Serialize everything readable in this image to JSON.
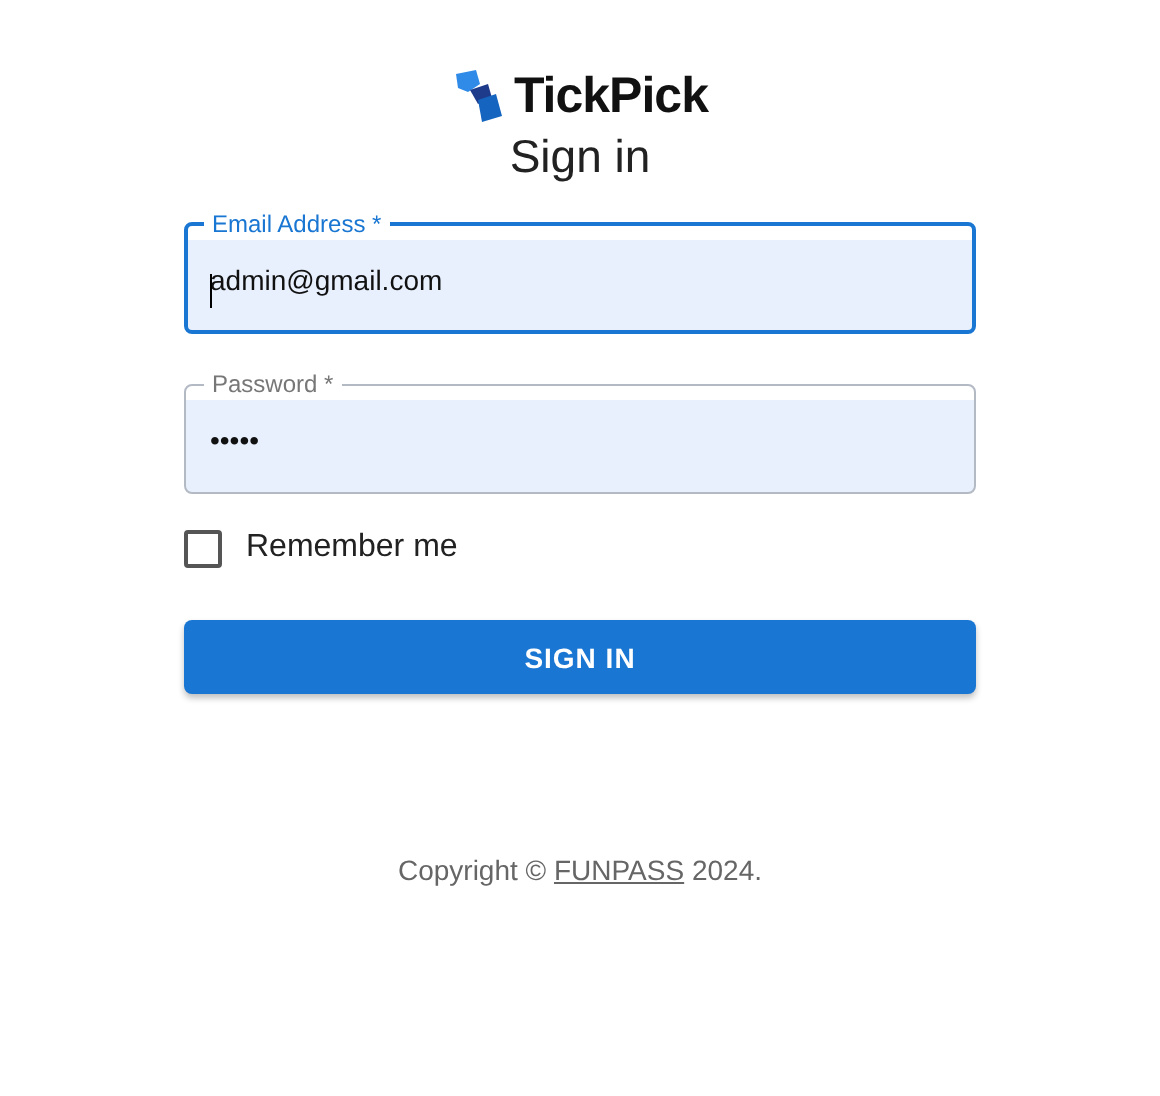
{
  "brand": {
    "name": "TickPick"
  },
  "title": "Sign in",
  "fields": [
    {
      "label": "Email Address *",
      "value": "admin@gmail.com",
      "focused": true
    },
    {
      "label": "Password *",
      "value": "•••••",
      "focused": false
    }
  ],
  "remember": {
    "label": "Remember me",
    "checked": false
  },
  "button": "SIGN IN",
  "footer": {
    "prefix": "Copyright © ",
    "link": "FUNPASS",
    "suffix": " 2024."
  }
}
